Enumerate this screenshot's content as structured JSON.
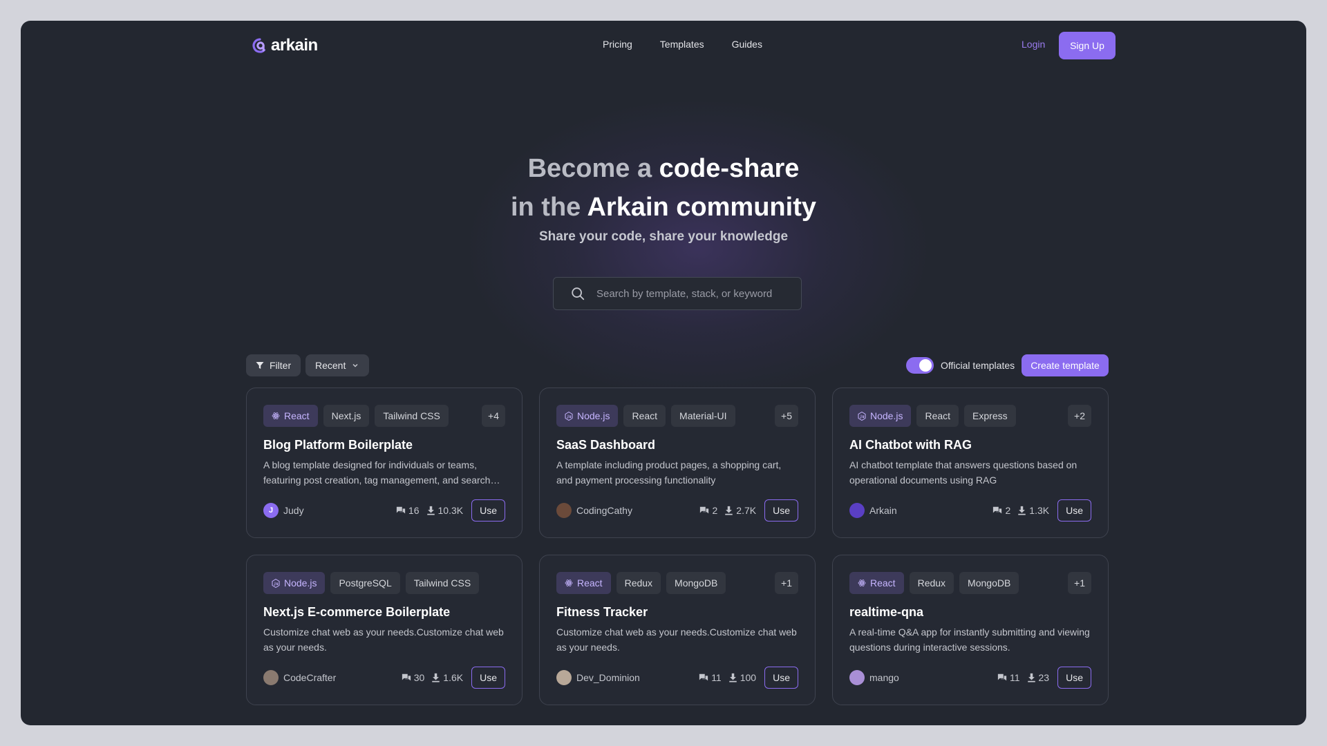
{
  "header": {
    "logo_text": "arkain",
    "nav": [
      "Pricing",
      "Templates",
      "Guides"
    ],
    "login": "Login",
    "signup": "Sign Up"
  },
  "hero": {
    "title_line1_a": "Become a ",
    "title_line1_b": "code-share",
    "title_line2_a": "in the ",
    "title_line2_b": "Arkain community",
    "subtitle": "Share your code, share your knowledge",
    "search_placeholder": "Search by template, stack, or keyword"
  },
  "toolbar": {
    "filter": "Filter",
    "sort": "Recent",
    "toggle_label": "Official templates",
    "create": "Create template"
  },
  "colors": {
    "accent": "#8b6cf0",
    "background": "#232730",
    "card": "#252933"
  },
  "cards": [
    {
      "tags": [
        "React",
        "Next.js",
        "Tailwind CSS"
      ],
      "tag_icon": "react-icon",
      "more": "+4",
      "title": "Blog Platform Boilerplate",
      "desc": "A blog template designed for individuals or teams, featuring post creation, tag management, and search functionality.",
      "author": "Judy",
      "avatar_letter": "J",
      "avatar_color": "#8b6cf0",
      "comments": "16",
      "downloads": "10.3K",
      "use": "Use"
    },
    {
      "tags": [
        "Node.js",
        "React",
        "Material-UI"
      ],
      "tag_icon": "nodejs-icon",
      "more": "+5",
      "title": "SaaS Dashboard",
      "desc": "A template including product pages, a shopping cart, and payment processing functionality",
      "author": "CodingCathy",
      "avatar_letter": "",
      "avatar_color": "#6b4a3a",
      "comments": "2",
      "downloads": "2.7K",
      "use": "Use"
    },
    {
      "tags": [
        "Node.js",
        "React",
        "Express"
      ],
      "tag_icon": "nodejs-icon",
      "more": "+2",
      "title": "AI Chatbot with RAG",
      "desc": "AI chatbot template that answers questions based on operational documents using RAG",
      "author": "Arkain",
      "avatar_letter": "",
      "avatar_color": "#5a3fc4",
      "comments": "2",
      "downloads": "1.3K",
      "use": "Use"
    },
    {
      "tags": [
        "Node.js",
        "PostgreSQL",
        "Tailwind CSS"
      ],
      "tag_icon": "nodejs-icon",
      "more": "",
      "title": "Next.js E-commerce Boilerplate",
      "desc": "Customize chat web as your needs.Customize chat web as your needs.",
      "author": "CodeCrafter",
      "avatar_letter": "",
      "avatar_color": "#8a7a70",
      "comments": "30",
      "downloads": "1.6K",
      "use": "Use"
    },
    {
      "tags": [
        "React",
        "Redux",
        "MongoDB"
      ],
      "tag_icon": "react-icon",
      "more": "+1",
      "title": "Fitness Tracker",
      "desc": "Customize chat web as your needs.Customize chat web as your needs.",
      "author": "Dev_Dominion",
      "avatar_letter": "",
      "avatar_color": "#b8a898",
      "comments": "11",
      "downloads": "100",
      "use": "Use"
    },
    {
      "tags": [
        "React",
        "Redux",
        "MongoDB"
      ],
      "tag_icon": "react-icon",
      "more": "+1",
      "title": "realtime-qna",
      "desc": "A real-time Q&A app for instantly submitting and viewing questions during interactive sessions.",
      "author": "mango",
      "avatar_letter": "",
      "avatar_color": "#a98fd6",
      "comments": "11",
      "downloads": "23",
      "use": "Use"
    }
  ]
}
